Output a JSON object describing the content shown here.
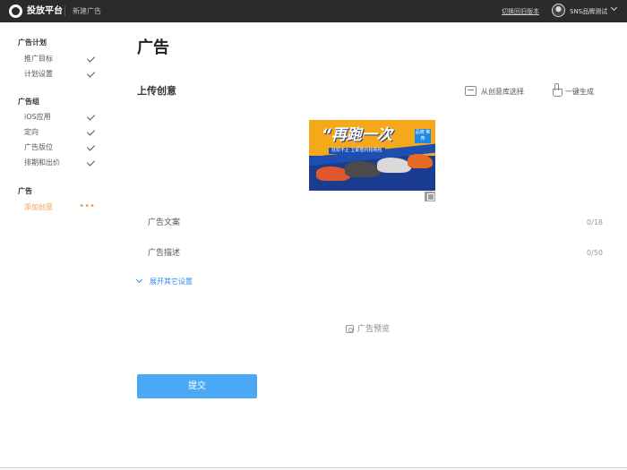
{
  "header": {
    "brand": "投放平台",
    "breadcrumb": "新建广告",
    "switch_link": "切换回旧版本",
    "user_name": "SNS品牌测试"
  },
  "sidebar": {
    "sections": [
      {
        "title": "广告计划",
        "items": [
          {
            "label": "推广目标",
            "status": "done"
          },
          {
            "label": "计划设置",
            "status": "done"
          }
        ]
      },
      {
        "title": "广告组",
        "items": [
          {
            "label": "iOS应用",
            "status": "done"
          },
          {
            "label": "定向",
            "status": "done"
          },
          {
            "label": "广告版位",
            "status": "done"
          },
          {
            "label": "排期和出价",
            "status": "done"
          }
        ]
      },
      {
        "title": "广告",
        "items": [
          {
            "label": "添加创意",
            "status": "in-progress"
          }
        ]
      }
    ]
  },
  "main": {
    "page_title": "广告",
    "section_heading": "上传创意",
    "library_button": "从创意库选择",
    "generate_button": "一键生成",
    "creative": {
      "headline": "“再跑一次",
      "badge": "品牌 推荐",
      "subline": "狂欢不止  立即签约抢购包"
    },
    "fields": [
      {
        "label": "广告文案",
        "count": "0/18"
      },
      {
        "label": "广告描述",
        "count": "0/50"
      }
    ],
    "expand_link": "展开其它设置",
    "preview_link": "广告预览",
    "submit_button": "提交"
  },
  "colors": {
    "accent": "#2d8cf0",
    "submit": "#4aa8f5",
    "active_nav": "#f0a04b",
    "topbar": "#2b2b2b"
  }
}
